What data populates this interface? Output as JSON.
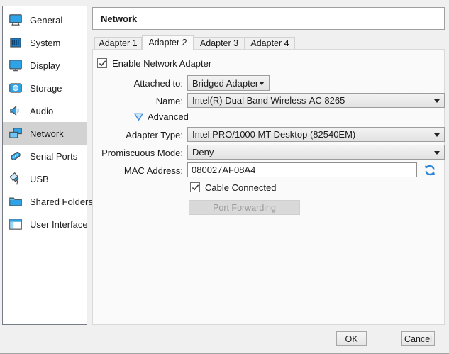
{
  "header": {
    "title": "Network"
  },
  "sidebar": {
    "items": [
      {
        "label": "General"
      },
      {
        "label": "System"
      },
      {
        "label": "Display"
      },
      {
        "label": "Storage"
      },
      {
        "label": "Audio"
      },
      {
        "label": "Network"
      },
      {
        "label": "Serial Ports"
      },
      {
        "label": "USB"
      },
      {
        "label": "Shared Folders"
      },
      {
        "label": "User Interface"
      }
    ],
    "selected": "Network"
  },
  "tabs": {
    "items": [
      {
        "label": "Adapter 1"
      },
      {
        "label": "Adapter 2"
      },
      {
        "label": "Adapter 3"
      },
      {
        "label": "Adapter 4"
      }
    ],
    "selected": "Adapter 2"
  },
  "form": {
    "enable": {
      "label": "Enable Network Adapter",
      "checked": true
    },
    "attached_to": {
      "label": "Attached to:",
      "value": "Bridged Adapter"
    },
    "name": {
      "label": "Name:",
      "value": "Intel(R) Dual Band Wireless-AC 8265"
    },
    "advanced": {
      "label": "Advanced",
      "expanded": true
    },
    "adapter_type": {
      "label": "Adapter Type:",
      "value": "Intel PRO/1000 MT Desktop (82540EM)"
    },
    "promiscuous_mode": {
      "label": "Promiscuous Mode:",
      "value": "Deny"
    },
    "mac_address": {
      "label": "MAC Address:",
      "value": "080027AF08A4"
    },
    "cable_connected": {
      "label": "Cable Connected",
      "checked": true
    },
    "port_forwarding": {
      "label": "Port Forwarding",
      "enabled": false
    }
  },
  "footer": {
    "ok": "OK",
    "cancel": "Cancel"
  },
  "colors": {
    "icon_blue": "#2fa3e8",
    "icon_blue_light": "#6cc6f6",
    "selected_item_bg": "#d2d2d2",
    "advanced_arrow": "#3c8ede",
    "refresh_icon": "#2e86d9",
    "disabled_text": "#9a9a9a"
  }
}
